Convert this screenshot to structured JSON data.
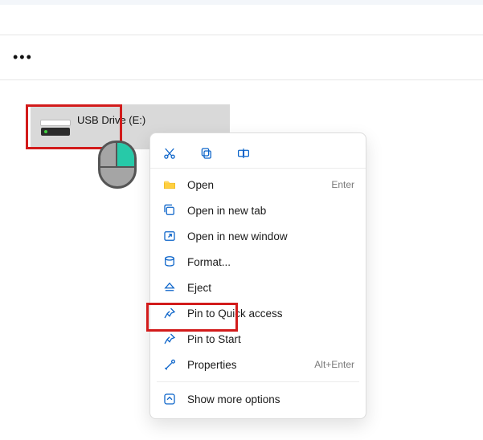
{
  "drive": {
    "label": "USB Drive (E:)"
  },
  "menu": {
    "open": {
      "label": "Open",
      "shortcut": "Enter"
    },
    "newtab": {
      "label": "Open in new tab"
    },
    "newwin": {
      "label": "Open in new window"
    },
    "format": {
      "label": "Format..."
    },
    "eject": {
      "label": "Eject"
    },
    "pinquick": {
      "label": "Pin to Quick access"
    },
    "pinstart": {
      "label": "Pin to Start"
    },
    "properties": {
      "label": "Properties",
      "shortcut": "Alt+Enter"
    },
    "moreopts": {
      "label": "Show more options"
    }
  }
}
